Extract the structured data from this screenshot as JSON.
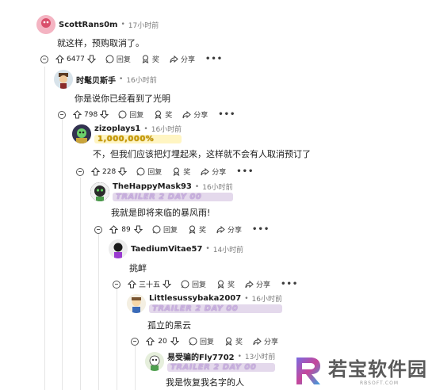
{
  "comments": [
    {
      "username": "ScottRans0m",
      "time": "17小时前",
      "flair": "",
      "text": "就这样，预购取消了。",
      "score": "6477"
    },
    {
      "username": "时髦贝斯手",
      "time": "16小时前",
      "flair": "",
      "text": "你是说你已经看到了光明",
      "score": "798"
    },
    {
      "username": "zizoplays1",
      "time": "16小时前",
      "flair": "1,000,000%",
      "text": "不，但我们应该把灯埋起来，这样就不会有人取消预订了",
      "score": "228"
    },
    {
      "username": "TheHappyMask93",
      "time": "16小时前",
      "flair": "TRAILER 2 DAY 00",
      "text": "我就是即将来临的暴风雨!",
      "score": "89"
    },
    {
      "username": "TaediumVitae57",
      "time": "14小时前",
      "flair": "",
      "text": "挑衅",
      "score": "三十五"
    },
    {
      "username": "Littlesussybaka2007",
      "time": "16小时前",
      "flair": "TRAILER 2 DAY 00",
      "text": "孤立的黑云",
      "score": "20"
    },
    {
      "username": "易受骗的Fly7702",
      "time": "13小时前",
      "flair": "TRAILER 2 DAY 00",
      "text": "我是恢复我名字的人",
      "score": ""
    }
  ],
  "actions": {
    "reply": "回复",
    "award": "奖",
    "share": "分享",
    "more": "•••"
  },
  "separator": "•",
  "watermark": {
    "brand": "若宝软件园",
    "url": "RBSOFT.COM"
  },
  "colors": {
    "accent": "#c6469a",
    "flair_trailer": "#e4d9ec",
    "flair_million": "#fff5c2"
  }
}
